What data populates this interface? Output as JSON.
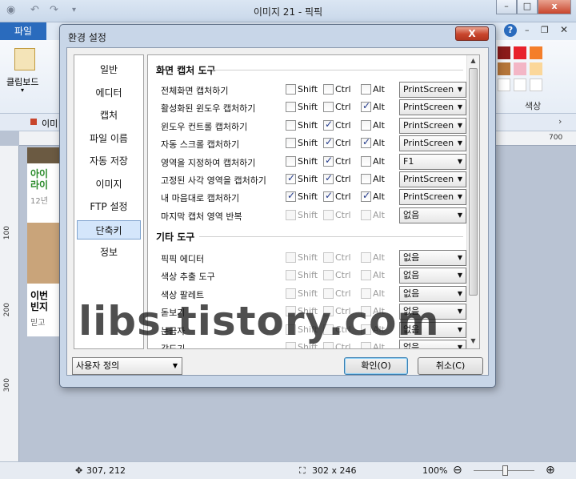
{
  "app": {
    "title": "이미지 21 - 픽픽",
    "file_tab": "파일",
    "ribbon_clipboard": "클립보드",
    "doc_tab": "이미",
    "ribbon_colors": "색상",
    "help_icon": "?"
  },
  "ruler": {
    "top_700": "700",
    "left_100": "100",
    "left_200": "200",
    "left_300": "300"
  },
  "canvas_text": {
    "line1": "아이",
    "line2": "라이",
    "line3": "12년",
    "line4": "이번",
    "line5": "빈지",
    "line6": "믿고"
  },
  "status": {
    "cursor_pos": "307, 212",
    "selection_size": "302 x 246",
    "zoom": "100%"
  },
  "watermark": "libs.tistory.com",
  "dialog": {
    "title": "환경 설정",
    "close_label": "X",
    "nav": [
      "일반",
      "에디터",
      "캡처",
      "파일 이름",
      "자동 저장",
      "이미지",
      "FTP 설정",
      "단축키",
      "정보"
    ],
    "selected_nav": "단축키",
    "sections": {
      "capture_tools": "화면 캡처 도구",
      "other_tools": "기타 도구"
    },
    "modifier_labels": {
      "shift": "Shift",
      "ctrl": "Ctrl",
      "alt": "Alt"
    },
    "capture_rows": [
      {
        "label": "전체화면 캡처하기",
        "shift": false,
        "ctrl": false,
        "alt": false,
        "key": "PrintScreen",
        "enabled": true
      },
      {
        "label": "활성화된 윈도우 캡처하기",
        "shift": false,
        "ctrl": false,
        "alt": true,
        "key": "PrintScreen",
        "enabled": true
      },
      {
        "label": "윈도우 컨트롤 캡처하기",
        "shift": false,
        "ctrl": true,
        "alt": false,
        "key": "PrintScreen",
        "enabled": true
      },
      {
        "label": "자동 스크롤 캡처하기",
        "shift": false,
        "ctrl": true,
        "alt": true,
        "key": "PrintScreen",
        "enabled": true
      },
      {
        "label": "영역을 지정하여 캡처하기",
        "shift": false,
        "ctrl": true,
        "alt": false,
        "key": "F1",
        "enabled": true
      },
      {
        "label": "고정된 사각 영역을 캡처하기",
        "shift": true,
        "ctrl": true,
        "alt": false,
        "key": "PrintScreen",
        "enabled": true
      },
      {
        "label": "내 마음대로 캡처하기",
        "shift": true,
        "ctrl": true,
        "alt": true,
        "key": "PrintScreen",
        "enabled": true
      },
      {
        "label": "마지막 캡처 영역 반복",
        "shift": false,
        "ctrl": false,
        "alt": false,
        "key": "없음",
        "enabled": false
      }
    ],
    "other_rows": [
      {
        "label": "픽픽 에디터",
        "shift": false,
        "ctrl": false,
        "alt": false,
        "key": "없음",
        "enabled": false
      },
      {
        "label": "색상 추출 도구",
        "shift": false,
        "ctrl": false,
        "alt": false,
        "key": "없음",
        "enabled": false
      },
      {
        "label": "색상 팔레트",
        "shift": false,
        "ctrl": false,
        "alt": false,
        "key": "없음",
        "enabled": false
      },
      {
        "label": "돋보기",
        "shift": false,
        "ctrl": false,
        "alt": false,
        "key": "없음",
        "enabled": false
      },
      {
        "label": "눈금자",
        "shift": false,
        "ctrl": false,
        "alt": false,
        "key": "없음",
        "enabled": false
      },
      {
        "label": "각도기",
        "shift": false,
        "ctrl": false,
        "alt": false,
        "key": "없음",
        "enabled": false
      }
    ],
    "profile": "사용자 정의",
    "ok_label": "확인(O)",
    "cancel_label": "취소(C)"
  },
  "colors": {
    "file_tab": "#2a6bbd",
    "close_button": "#c8452c",
    "nav_selected": "#d4e6fb",
    "check_mark": "#21398a"
  }
}
